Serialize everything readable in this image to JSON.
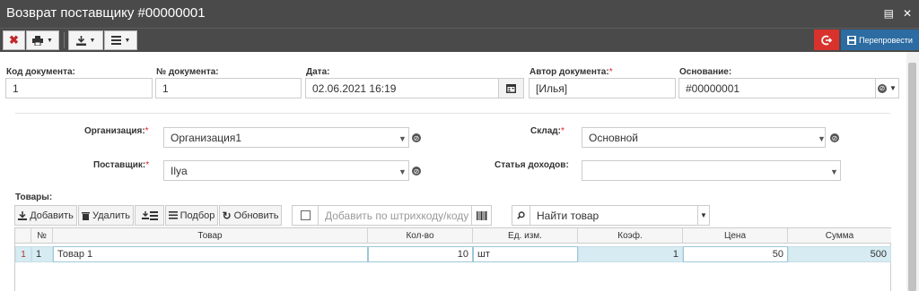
{
  "window": {
    "title": "Возврат поставщику #00000001"
  },
  "toolbar": {
    "repost_label": "Перепровести"
  },
  "fields": {
    "doc_code": {
      "label": "Код документа:",
      "value": "1"
    },
    "doc_number": {
      "label": "№ документа:",
      "value": "1"
    },
    "date": {
      "label": "Дата:",
      "value": "02.06.2021 16:19"
    },
    "author": {
      "label": "Автор документа:",
      "value": "[Илья]"
    },
    "basis": {
      "label": "Основание:",
      "value": "#00000001"
    },
    "organization": {
      "label": "Организация:",
      "value": "Организация1"
    },
    "warehouse": {
      "label": "Склад:",
      "value": "Основной"
    },
    "supplier": {
      "label": "Поставщик:",
      "value": "Ilya"
    },
    "income_item": {
      "label": "Статья доходов:",
      "value": ""
    },
    "required_mark": "*"
  },
  "goods": {
    "title": "Товары:",
    "buttons": {
      "add": "Добавить",
      "delete": "Удалить",
      "pick": "Подбор",
      "refresh": "Обновить"
    },
    "barcode_placeholder": "Добавить по штрихкоду/коду",
    "find_placeholder": "Найти товар",
    "columns": [
      "№",
      "Товар",
      "Кол-во",
      "Ед. изм.",
      "Коэф.",
      "Цена",
      "Сумма"
    ],
    "rows": [
      {
        "idx": "1",
        "num": "1",
        "name": "Товар 1",
        "qty": "10",
        "unit": "шт",
        "coef": "1",
        "price": "50",
        "sum": "500"
      }
    ]
  },
  "colors": {
    "titlebar": "#4a4a4a",
    "danger": "#d9322c",
    "primary": "#2d6ca2",
    "selected_row": "#d6ebf2"
  }
}
